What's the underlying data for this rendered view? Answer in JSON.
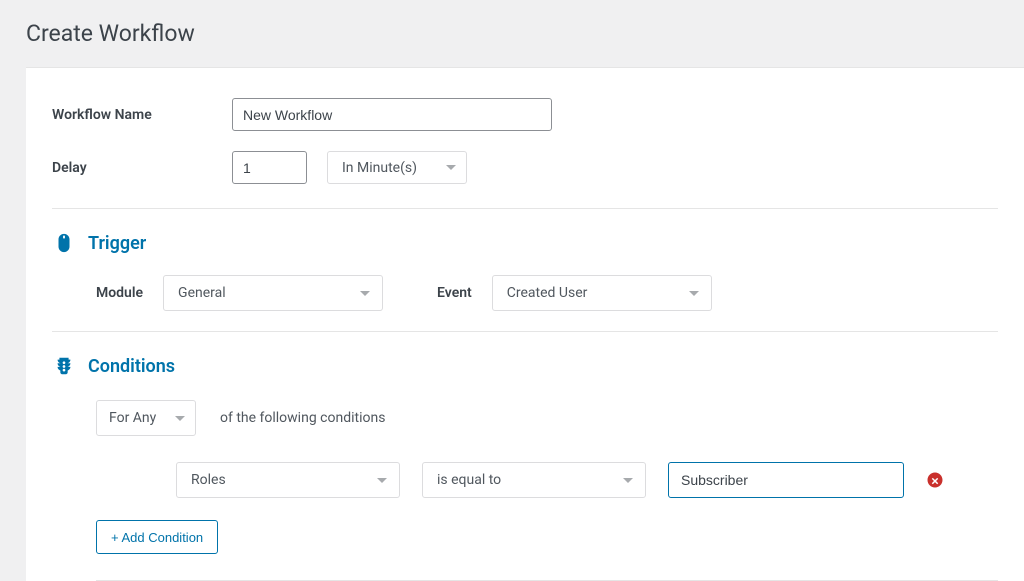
{
  "page": {
    "title": "Create Workflow"
  },
  "form": {
    "workflowNameLabel": "Workflow Name",
    "workflowNameValue": "New Workflow",
    "delayLabel": "Delay",
    "delayValue": "1",
    "delayUnit": "In Minute(s)"
  },
  "trigger": {
    "title": "Trigger",
    "moduleLabel": "Module",
    "moduleValue": "General",
    "eventLabel": "Event",
    "eventValue": "Created User"
  },
  "conditions": {
    "title": "Conditions",
    "matchType": "For Any",
    "matchDesc": "of the following conditions",
    "rows": [
      {
        "field": "Roles",
        "operator": "is equal to",
        "value": "Subscriber"
      }
    ],
    "addButton": "+ Add Condition"
  },
  "colors": {
    "accent": "#0073aa",
    "danger": "#c9302c"
  }
}
